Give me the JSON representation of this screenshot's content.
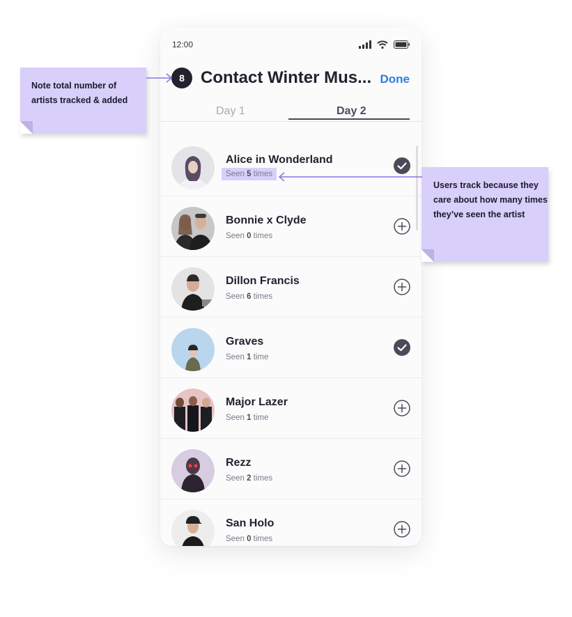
{
  "status_bar": {
    "time": "12:00"
  },
  "header": {
    "count": "8",
    "title": "Contact Winter Mus...",
    "done_label": "Done"
  },
  "tabs": [
    {
      "label": "Day 1",
      "selected": false
    },
    {
      "label": "Day 2",
      "selected": true
    }
  ],
  "artists": [
    {
      "name": "Alice in Wonderland",
      "seen_prefix": "Seen",
      "seen_count": "5",
      "seen_suffix": "times",
      "tracked": true
    },
    {
      "name": "Bonnie x Clyde",
      "seen_prefix": "Seen",
      "seen_count": "0",
      "seen_suffix": "times",
      "tracked": false
    },
    {
      "name": "Dillon Francis",
      "seen_prefix": "Seen",
      "seen_count": "6",
      "seen_suffix": "times",
      "tracked": false
    },
    {
      "name": "Graves",
      "seen_prefix": "Seen",
      "seen_count": "1",
      "seen_suffix": "time",
      "tracked": true
    },
    {
      "name": "Major Lazer",
      "seen_prefix": "Seen",
      "seen_count": "1",
      "seen_suffix": "time",
      "tracked": false
    },
    {
      "name": "Rezz",
      "seen_prefix": "Seen",
      "seen_count": "2",
      "seen_suffix": "times",
      "tracked": false
    },
    {
      "name": "San Holo",
      "seen_prefix": "Seen",
      "seen_count": "0",
      "seen_suffix": "times",
      "tracked": false
    }
  ],
  "annotations": {
    "count_note": "Note total number of artists tracked & added",
    "seen_note": "Users track because they care about how many times they’ve seen the artist"
  },
  "colors": {
    "accent": "#2b7fe0",
    "dark": "#23212e",
    "note": "#d8cffb",
    "arrow": "#8f72e0"
  }
}
